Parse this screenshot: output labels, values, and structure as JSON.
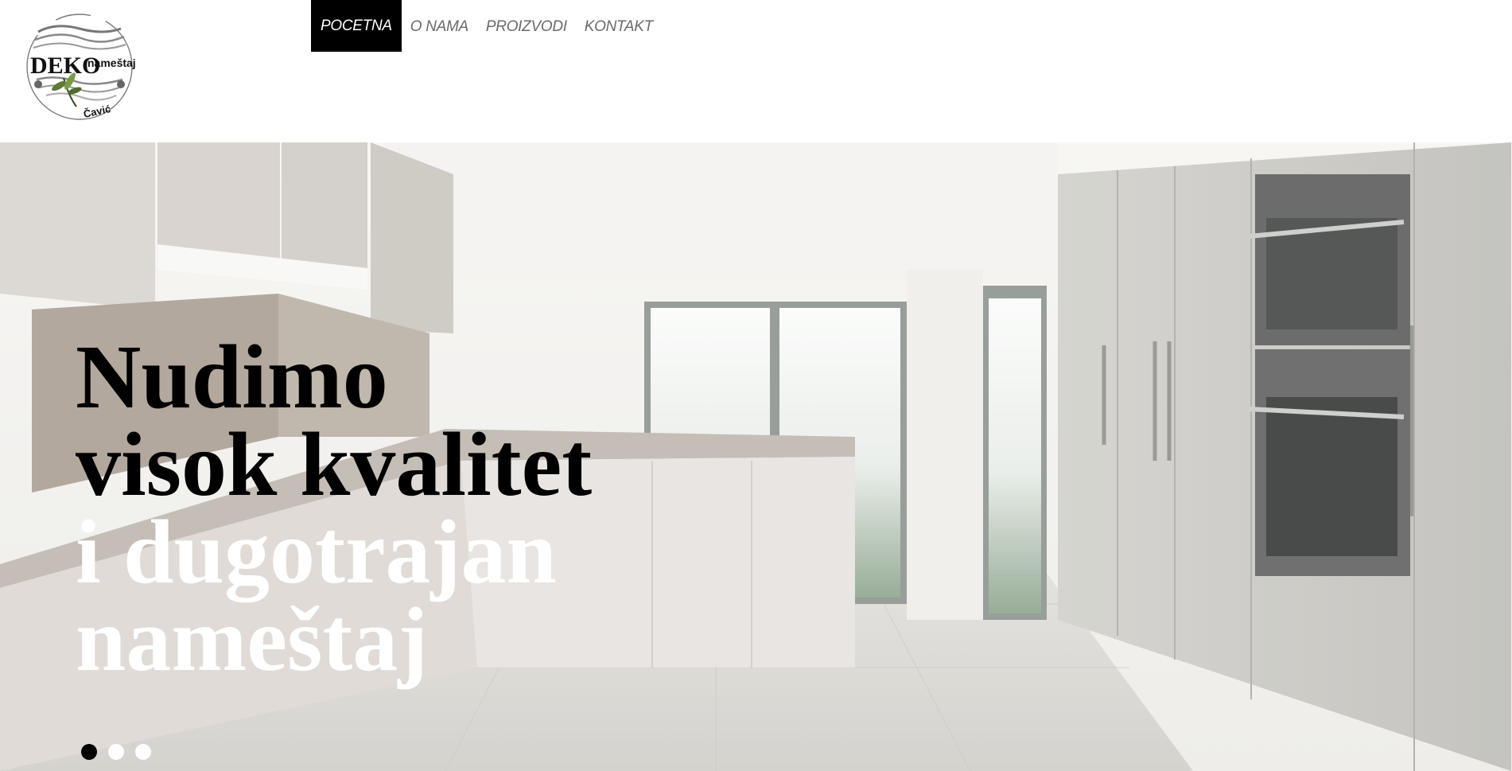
{
  "logo": {
    "brand": "DEKO",
    "word": "nameštaj",
    "owner": "Čavić"
  },
  "nav": {
    "items": [
      {
        "label": "POCETNA",
        "active": true
      },
      {
        "label": "O NAMA",
        "active": false
      },
      {
        "label": "PROIZVODI",
        "active": false
      },
      {
        "label": "KONTAKT",
        "active": false
      }
    ]
  },
  "hero": {
    "headline": {
      "line1": "Nudimo",
      "line2": "visok kvalitet",
      "line3": "i dugotrajan",
      "line4": "nameštaj"
    },
    "slider": {
      "slide_count": 3,
      "active_index": 0
    }
  },
  "colors": {
    "nav_active_bg": "#000000",
    "nav_text": "#6a6a6a",
    "headline_dark": "#000000",
    "headline_light": "#ffffff"
  }
}
